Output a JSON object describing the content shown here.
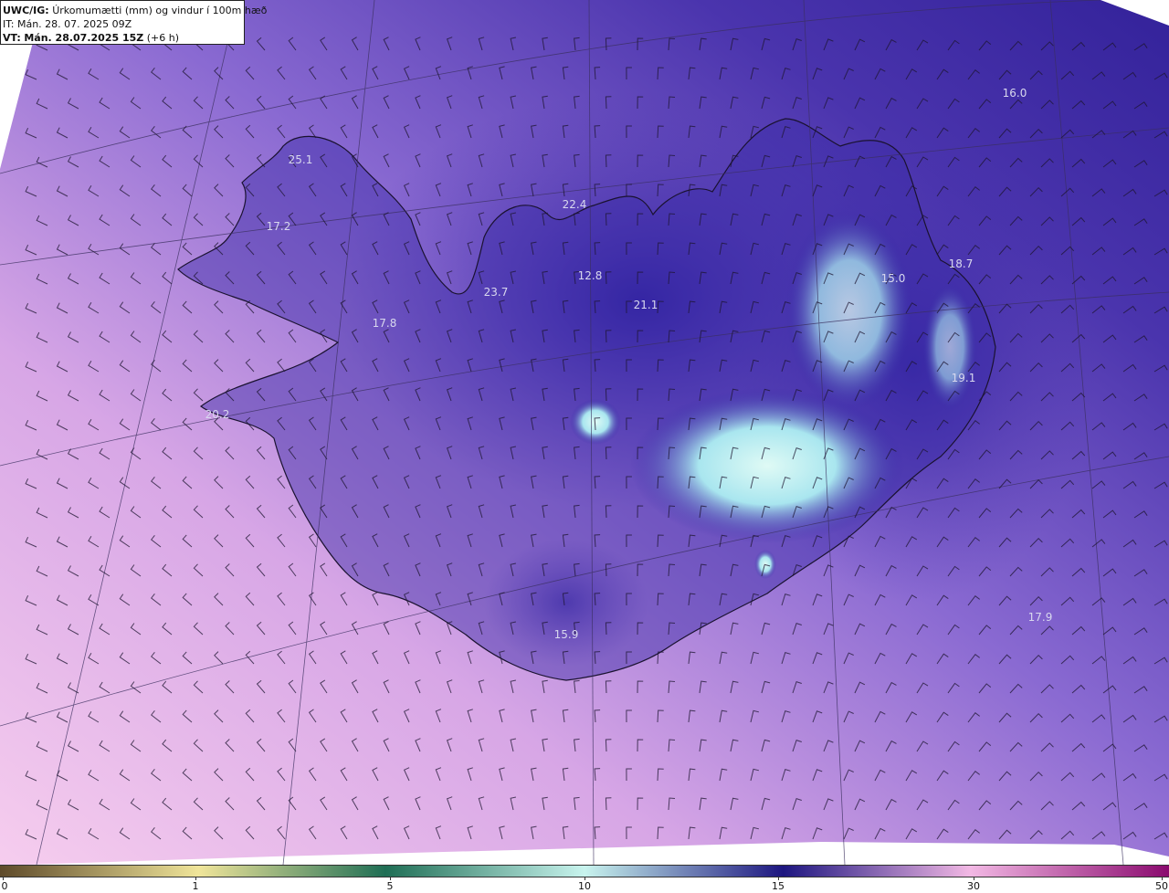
{
  "header": {
    "model": "UWC/IG:",
    "title": "Úrkomumætti (mm) og vindur í 100m hæð",
    "init_prefix": "IT:",
    "init_time": "Mán. 28. 07. 2025 09Z",
    "valid_prefix": "VT:",
    "valid_time": "Mán. 28.07.2025 15Z",
    "lead": "(+6 h)"
  },
  "value_labels": [
    "25.1",
    "17.2",
    "17.8",
    "20.2",
    "23.7",
    "22.4",
    "12.8",
    "21.1",
    "15.0",
    "18.7",
    "19.1",
    "16.0",
    "15.9",
    "17.9"
  ],
  "colorbar": {
    "ticks": [
      "0",
      "1",
      "5",
      "10",
      "15",
      "30",
      "50"
    ],
    "tick_values": [
      0,
      1,
      5,
      10,
      15,
      30,
      50
    ]
  },
  "colors": {
    "sea_low": "#f2c8ea",
    "sea_mid": "#b690d8",
    "sea_high": "#3c2a9c",
    "land_moist": "#2a1fa0",
    "peak": "#c6f2ee"
  }
}
